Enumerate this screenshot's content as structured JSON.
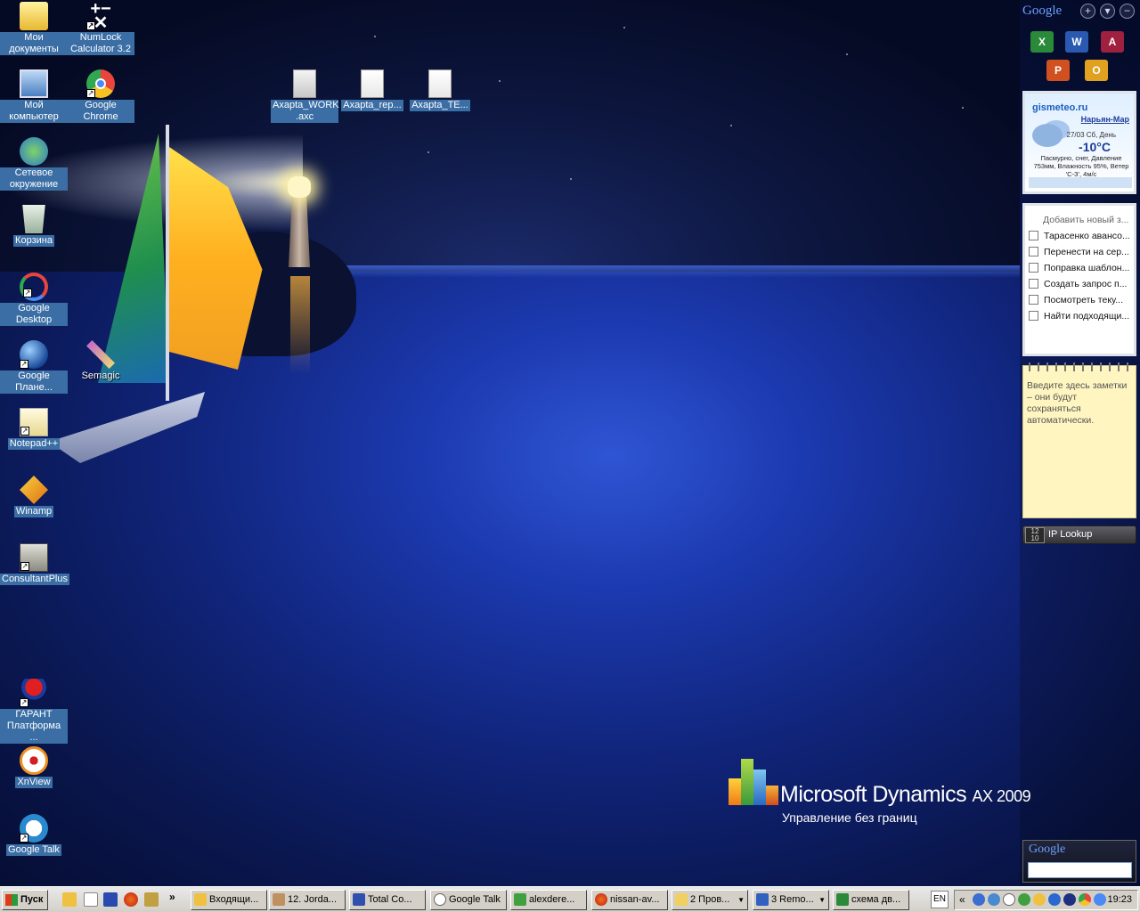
{
  "desktop": {
    "icons": [
      {
        "label": "Мои документы",
        "icon": "my-documents-icon"
      },
      {
        "label": "NumLock Calculator 3.2",
        "icon": "calculator-icon"
      },
      {
        "label": "Мой компьютер",
        "icon": "my-computer-icon"
      },
      {
        "label": "Google Chrome",
        "icon": "chrome-icon"
      },
      {
        "label": "Сетевое окружение",
        "icon": "network-icon"
      },
      {
        "label": "Корзина",
        "icon": "recycle-bin-icon"
      },
      {
        "label": "Google Desktop",
        "icon": "google-desktop-icon"
      },
      {
        "label": "Google Плане...",
        "icon": "google-earth-icon"
      },
      {
        "label": "Semagic",
        "icon": "semagic-icon"
      },
      {
        "label": "Notepad++",
        "icon": "notepad-icon"
      },
      {
        "label": "Winamp",
        "icon": "winamp-icon"
      },
      {
        "label": "ConsultantPlus",
        "icon": "consultant-icon"
      },
      {
        "label": "ГАРАНТ Платформа ...",
        "icon": "garant-icon"
      },
      {
        "label": "XnView",
        "icon": "xnview-icon"
      },
      {
        "label": "Google Talk",
        "icon": "google-talk-icon"
      },
      {
        "label": "Axapta_WORK .axc",
        "icon": "axapta-file-icon"
      },
      {
        "label": "Axapta_rep...",
        "icon": "axapta-file-icon"
      },
      {
        "label": "Axapta_TE...",
        "icon": "axapta-file-icon"
      }
    ]
  },
  "wallpaper": {
    "brand": "Microsoft Dynamics",
    "version": "AX 2009",
    "tagline": "Управление без границ"
  },
  "sidebar": {
    "logo": "Google",
    "weather": {
      "site": "gismeteo.ru",
      "city": "Нарьян-Мар",
      "date": "27/03 Сб, День",
      "temp": "-10°C",
      "desc": "Пасмурно, снег, Давление 753мм, Влажность 95%, Ветер 'С-З', 4м/с"
    },
    "todo": {
      "add_label": "Добавить новый з...",
      "items": [
        "Тарасенко авансо...",
        "Перенести на сер...",
        "Поправка шаблон...",
        "Создать запрос п...",
        "Посмотреть теку...",
        "Найти подходящи..."
      ]
    },
    "notes": {
      "text": "Введите здесь заметки – они будут сохраняться автоматически."
    },
    "ip_lookup": {
      "label": "IP Lookup"
    },
    "search": {
      "logo": "Google"
    }
  },
  "taskbar": {
    "start_label": "Пуск",
    "more_label": "»",
    "buttons": [
      {
        "label": "Входящи...",
        "icon": "mail-icon"
      },
      {
        "label": "12. Jorda...",
        "icon": "pen-icon"
      },
      {
        "label": "Total Co...",
        "icon": "total-commander-icon"
      },
      {
        "label": "Google Talk",
        "icon": "talk-icon"
      },
      {
        "label": "alexdere...",
        "icon": "chat-icon"
      },
      {
        "label": "nissan-av...",
        "icon": "firefox-icon"
      },
      {
        "label": "2 Пров...",
        "icon": "folder-icon"
      },
      {
        "label": "3 Remo...",
        "icon": "remote-icon"
      },
      {
        "label": "схема дв...",
        "icon": "excel-icon"
      }
    ],
    "lang": "EN",
    "tray_chevron": "«",
    "clock": "19:23"
  },
  "colors": {
    "selection": "#3a6ea5",
    "taskbar": "#d4d0c8",
    "sea": "#1c3ab0"
  }
}
